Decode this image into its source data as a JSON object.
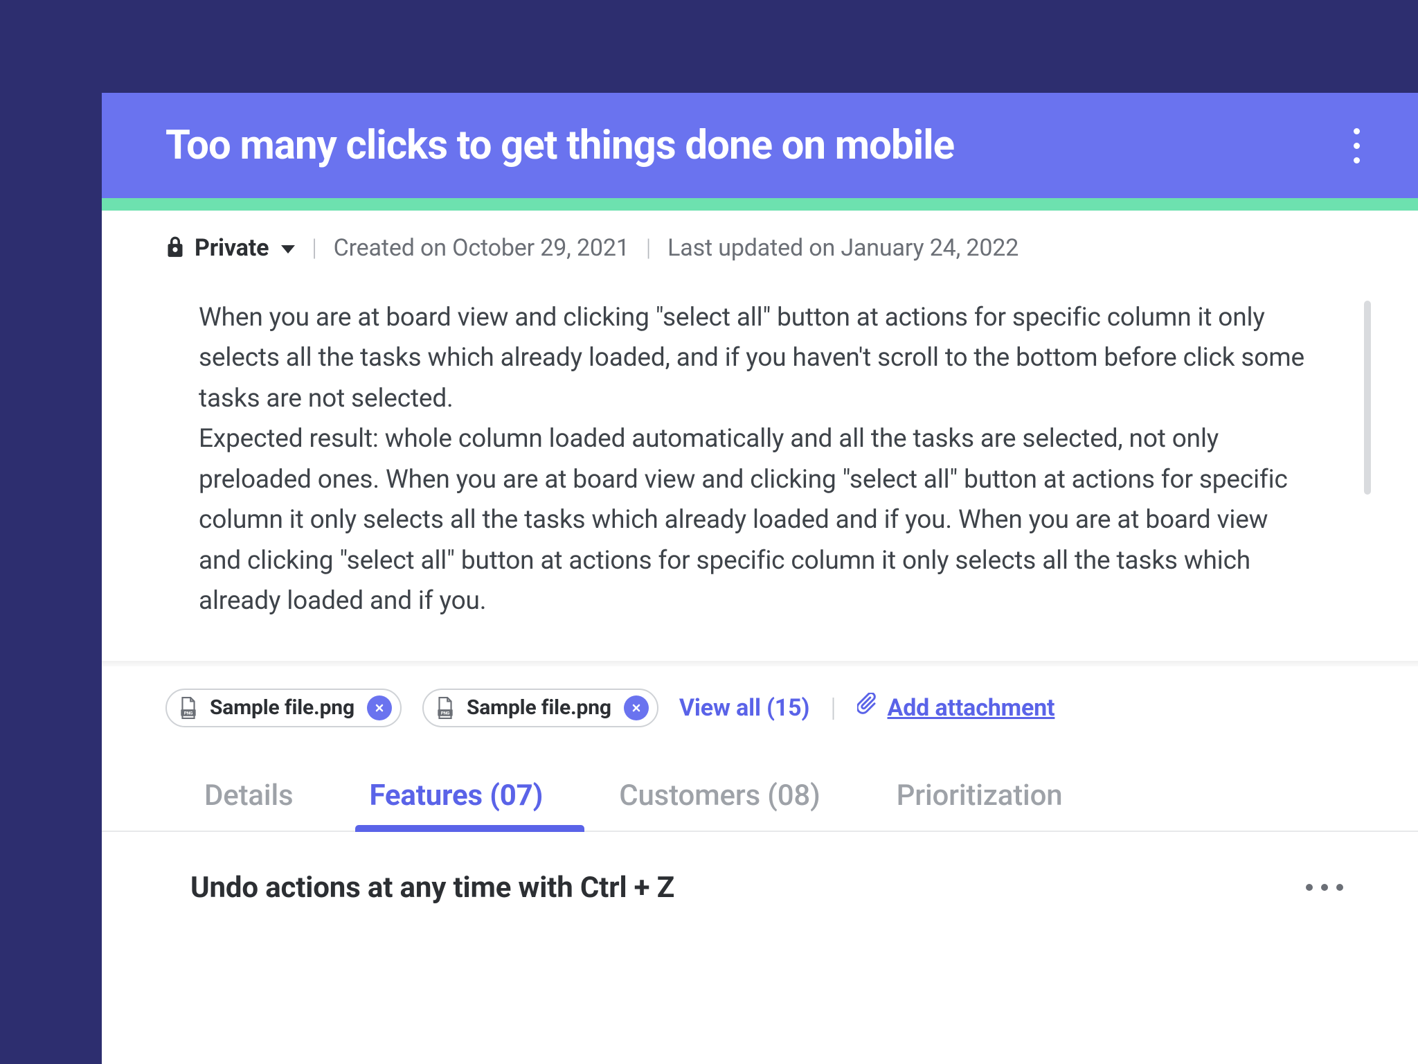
{
  "header": {
    "title": "Too many clicks to get things done on mobile"
  },
  "meta": {
    "visibility": "Private",
    "created": "Created on October 29, 2021",
    "updated": "Last updated on January 24, 2022"
  },
  "description": "When you are at board view and clicking \"select all\" button at actions for specific column it only selects all the tasks which already loaded, and if you haven't scroll to the bottom before click some tasks are not selected.\nExpected result: whole column loaded automatically and all the tasks are selected, not only preloaded ones. When you are at board view and clicking \"select all\" button at actions for specific column it only selects all the tasks which already loaded and if you.  When you are at board view and clicking \"select all\" button at actions for specific column it only selects all the tasks which already loaded and if you.",
  "attachments": {
    "items": [
      {
        "name": "Sample file.png"
      },
      {
        "name": "Sample file.png"
      }
    ],
    "view_all_label": "View all (15)",
    "add_label": "Add attachment"
  },
  "tabs": [
    {
      "label": "Details",
      "active": false
    },
    {
      "label": "Features (07)",
      "active": true
    },
    {
      "label": "Customers (08)",
      "active": false
    },
    {
      "label": "Prioritization",
      "active": false
    }
  ],
  "feature": {
    "title": "Undo actions at any time with Ctrl + Z"
  }
}
